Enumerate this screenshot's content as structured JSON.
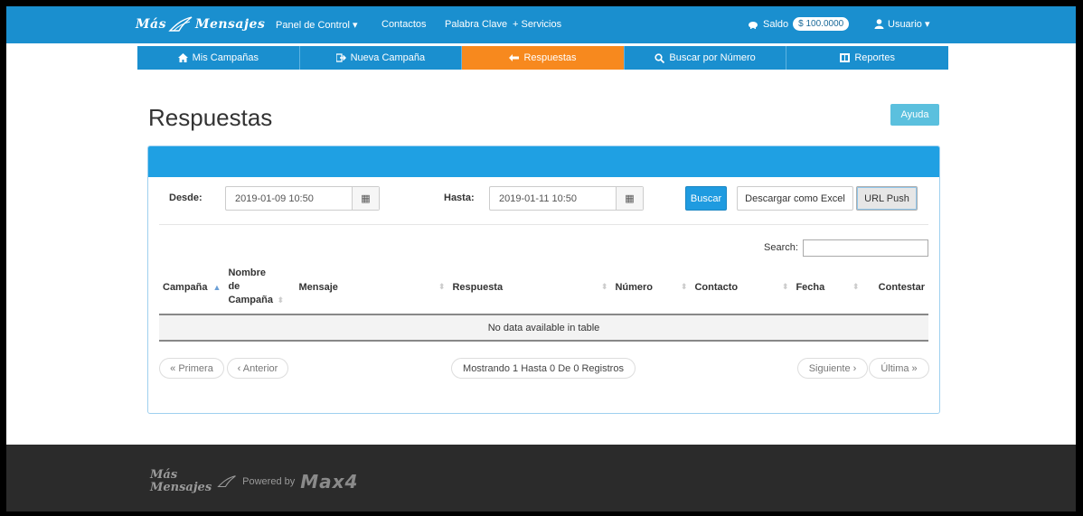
{
  "brand": {
    "part1": "Más",
    "part2": "Mensajes"
  },
  "topnav": {
    "panel": "Panel de Control ▾",
    "contactos": "Contactos",
    "palabra": "Palabra Clave",
    "servicios": "+ Servicios",
    "saldo_label": "Saldo",
    "saldo_value": "$ 100.0000",
    "usuario": "Usuario ▾"
  },
  "subnav": {
    "mis_campanas": "Mis Campañas",
    "nueva_campana": "Nueva Campaña",
    "respuestas": "Respuestas",
    "buscar_numero": "Buscar por Número",
    "reportes": "Reportes"
  },
  "page": {
    "title": "Respuestas",
    "help": "Ayuda"
  },
  "filters": {
    "desde_label": "Desde:",
    "desde_value": "2019-01-09 10:50",
    "hasta_label": "Hasta:",
    "hasta_value": "2019-01-11 10:50",
    "buscar": "Buscar",
    "excel": "Descargar como Excel",
    "url_push": "URL Push"
  },
  "table": {
    "search_label": "Search:",
    "columns": [
      "Campaña",
      "Nombre de Campaña",
      "Mensaje",
      "Respuesta",
      "Número",
      "Contacto",
      "Fecha",
      "Contestar"
    ],
    "empty": "No data available in table"
  },
  "pagination": {
    "first": "« Primera",
    "prev": "‹ Anterior",
    "info": "Mostrando 1 Hasta 0 De 0 Registros",
    "next": "Siguiente ›",
    "last": "Última »"
  },
  "footer": {
    "brand1": "Más",
    "brand2": "Mensajes",
    "powered": "Powered by",
    "max": "Max4"
  },
  "colors": {
    "primary": "#1a8fcf",
    "active_tab": "#f7891e",
    "footer": "#2b2b2b"
  }
}
